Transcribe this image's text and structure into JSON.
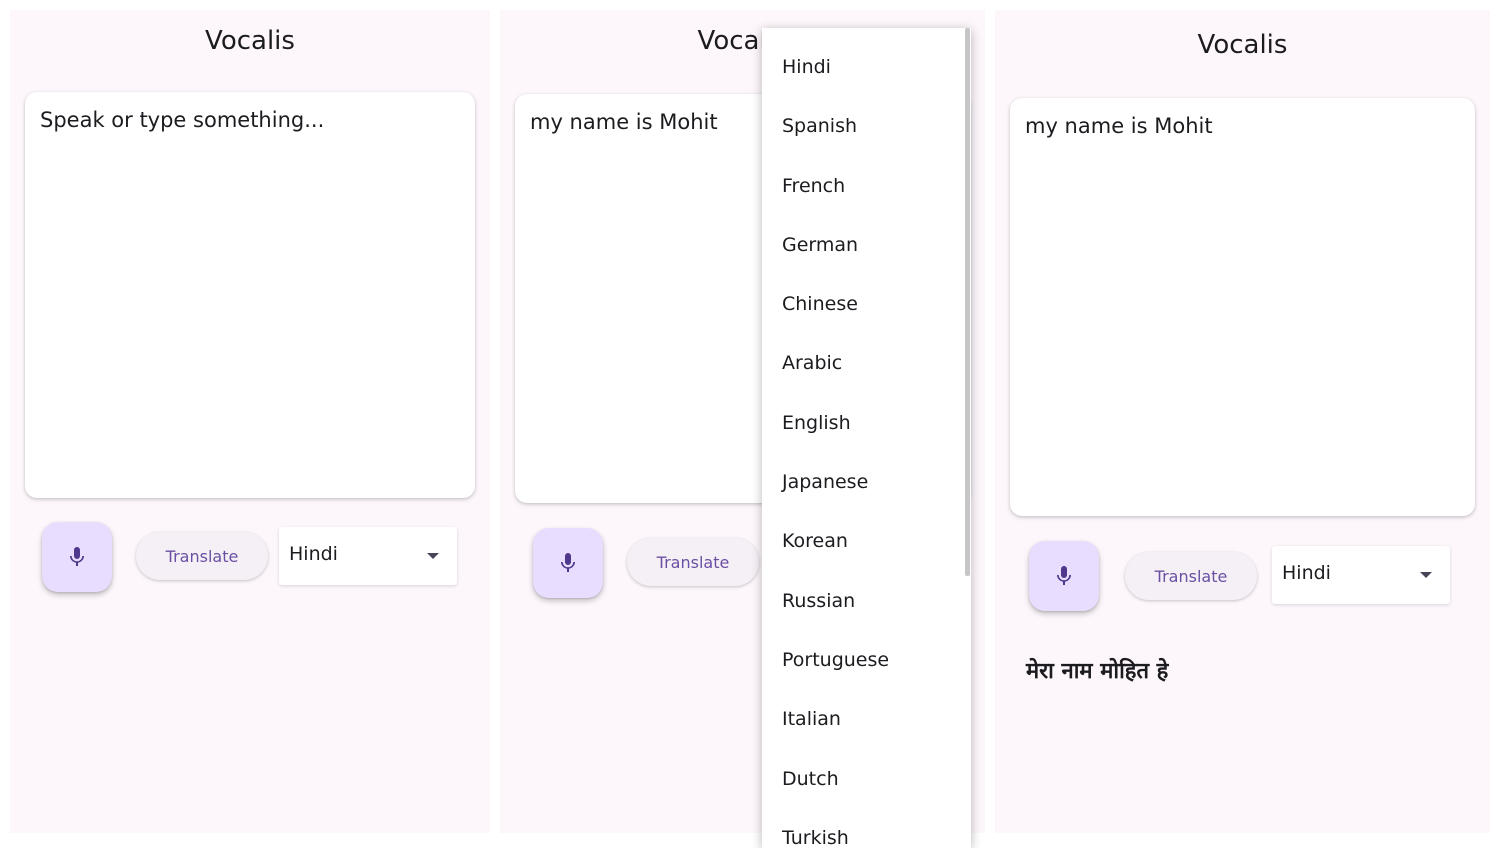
{
  "app": {
    "title": "Vocalis"
  },
  "screen1": {
    "input_placeholder": "Speak or type something...",
    "translate_label": "Translate",
    "language_selected": "Hindi"
  },
  "screen2": {
    "input_value": "my name is Mohit",
    "translate_label": "Translate",
    "language_options": [
      "Hindi",
      "Spanish",
      "French",
      "German",
      "Chinese",
      "Arabic",
      "English",
      "Japanese",
      "Korean",
      "Russian",
      "Portuguese",
      "Italian",
      "Dutch",
      "Turkish"
    ]
  },
  "screen3": {
    "input_value": "my name is Mohit",
    "translate_label": "Translate",
    "language_selected": "Hindi",
    "translation_result": "मेरा नाम मोहित हे"
  },
  "colors": {
    "background": "#fdf7fc",
    "mic_button": "#e9ddff",
    "accent": "#6a4fa3",
    "card": "#ffffff"
  },
  "icons": {
    "mic": "mic-icon",
    "dropdown_arrow": "arrow-drop-down-icon"
  }
}
